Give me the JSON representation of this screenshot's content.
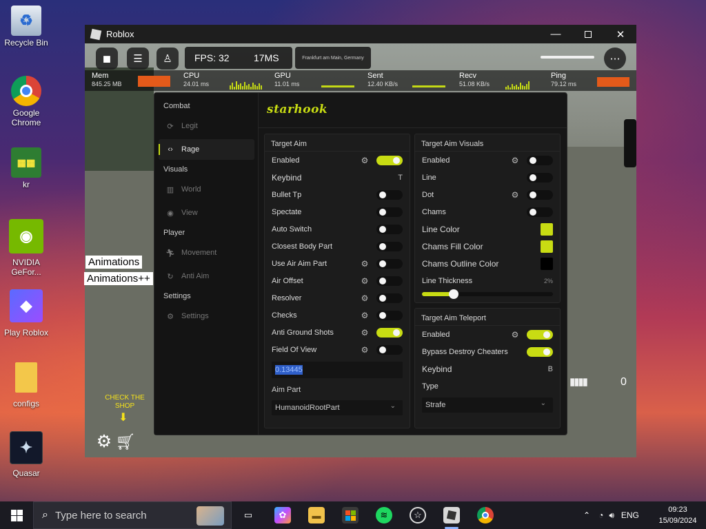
{
  "desktop": {
    "icons": [
      {
        "label": "Recycle Bin"
      },
      {
        "label": "Google Chrome"
      },
      {
        "label": "kr"
      },
      {
        "label": "NVIDIA GeFor..."
      },
      {
        "label": "Play Roblox"
      },
      {
        "label": "configs"
      },
      {
        "label": "Quasar"
      }
    ]
  },
  "window": {
    "title": "Roblox"
  },
  "hud": {
    "fps": "FPS: 32",
    "ms": "17MS",
    "location": "Frankfurt am Main, Germany",
    "stats": [
      {
        "label": "Mem",
        "value": "845.25 MB"
      },
      {
        "label": "CPU",
        "value": "24.01 ms"
      },
      {
        "label": "GPU",
        "value": "11.01 ms"
      },
      {
        "label": "Sent",
        "value": "12.40 KB/s"
      },
      {
        "label": "Recv",
        "value": "51.08 KB/s"
      },
      {
        "label": "Ping",
        "value": "79.12 ms"
      }
    ],
    "counter": "0"
  },
  "overlay": {
    "animations": "Animations",
    "animations_pp": "Animations++",
    "shop_hint": "CHECK THE SHOP"
  },
  "menu": {
    "logo": "starhook",
    "sidebar": {
      "combat": "Combat",
      "legit": "Legit",
      "rage": "Rage",
      "visuals": "Visuals",
      "world": "World",
      "view": "View",
      "player": "Player",
      "movement": "Movement",
      "antiaim": "Anti Aim",
      "settings_head": "Settings",
      "settings": "Settings"
    },
    "target_aim": {
      "title": "Target Aim",
      "rows": [
        {
          "label": "Enabled",
          "on": true
        },
        {
          "label": "Keybind",
          "key": "T"
        },
        {
          "label": "Bullet Tp",
          "on": false
        },
        {
          "label": "Spectate",
          "on": false
        },
        {
          "label": "Auto Switch",
          "on": false
        },
        {
          "label": "Closest Body Part",
          "on": false
        },
        {
          "label": "Use Air Aim Part",
          "on": false
        },
        {
          "label": "Air Offset",
          "on": false
        },
        {
          "label": "Resolver",
          "on": false
        },
        {
          "label": "Checks",
          "on": false
        },
        {
          "label": "Anti Ground Shots",
          "on": true
        },
        {
          "label": "Field Of View",
          "on": false
        }
      ],
      "fov_value": "0.13445",
      "aim_part_label": "Aim Part",
      "aim_part_value": "HumanoidRootPart"
    },
    "target_aim_visuals": {
      "title": "Target Aim Visuals",
      "rows": [
        {
          "label": "Enabled",
          "on": false
        },
        {
          "label": "Line",
          "on": false
        },
        {
          "label": "Dot",
          "on": false
        },
        {
          "label": "Chams",
          "on": false
        }
      ],
      "line_color_label": "Line Color",
      "line_color": "#c8dc13",
      "chams_fill_label": "Chams Fill Color",
      "chams_fill": "#c8dc13",
      "chams_outline_label": "Chams Outline Color",
      "chams_outline": "#000000",
      "thickness_label": "Line Thickness",
      "thickness_value": "2%",
      "thickness_fraction": 0.24
    },
    "target_aim_teleport": {
      "title": "Target Aim Teleport",
      "enabled_label": "Enabled",
      "enabled": true,
      "bypass_label": "Bypass Destroy Cheaters",
      "bypass": true,
      "keybind_label": "Keybind",
      "keybind": "B",
      "type_label": "Type",
      "type_value": "Strafe"
    }
  },
  "taskbar": {
    "search_placeholder": "Type here to search",
    "language": "ENG",
    "time": "09:23",
    "date": "15/09/2024"
  }
}
